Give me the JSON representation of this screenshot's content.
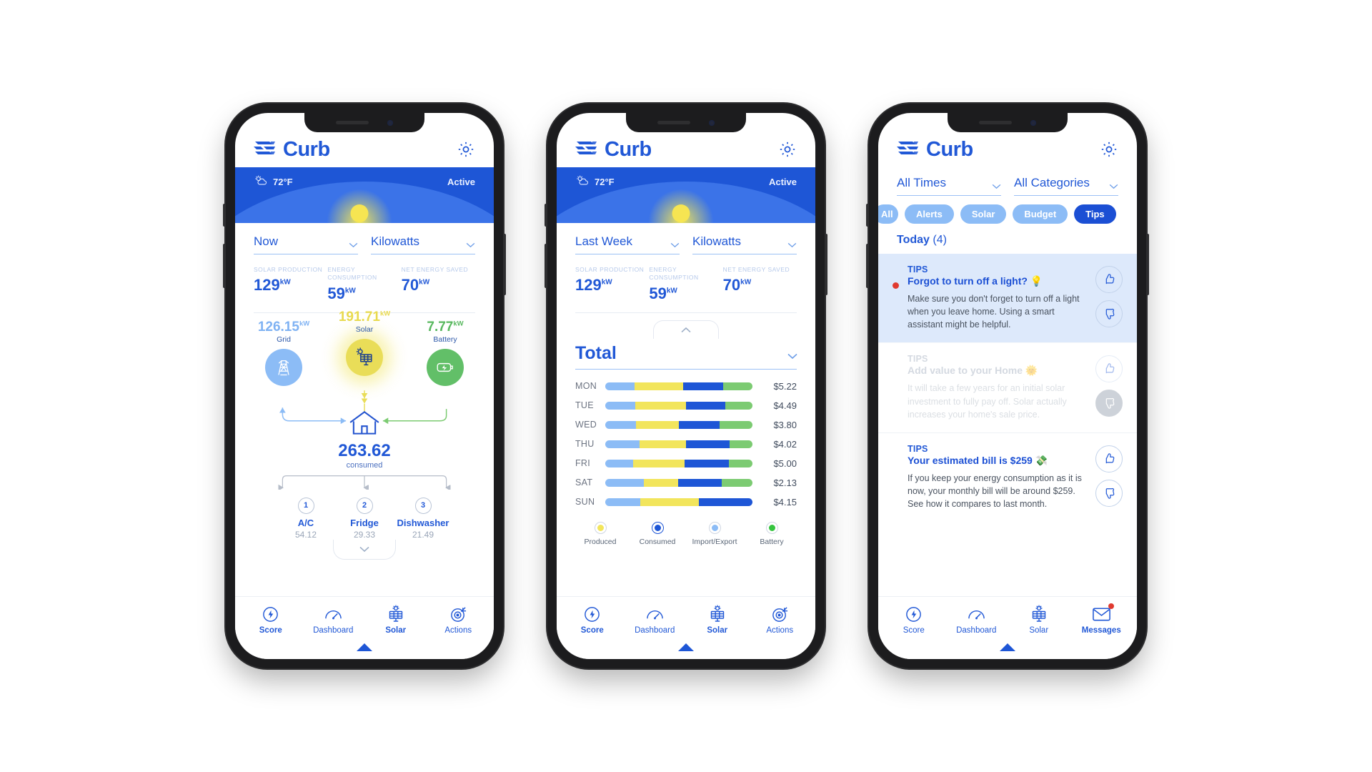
{
  "brand": {
    "name": "Curb",
    "logo_icon": "curb-logo-icon",
    "settings_icon": "gear-icon"
  },
  "phone1": {
    "weather": {
      "temperature": "72°F",
      "status": "Active",
      "icon": "partly-cloudy-icon"
    },
    "selectors": [
      {
        "name": "time-range",
        "value": "Now"
      },
      {
        "name": "units",
        "value": "Kilowatts"
      }
    ],
    "stats": [
      {
        "title": "SOLAR PRODUCTION",
        "value": "129",
        "unit": "kW"
      },
      {
        "title": "ENERGY CONSUMPTION",
        "value": "59",
        "unit": "kW"
      },
      {
        "title": "NET ENERGY SAVED",
        "value": "70",
        "unit": "kW"
      }
    ],
    "flow": {
      "grid": {
        "value": "126.15",
        "unit": "kW",
        "label": "Grid",
        "icon": "power-tower-icon"
      },
      "solar": {
        "value": "191.71",
        "unit": "kW",
        "label": "Solar",
        "icon": "solar-panel-icon"
      },
      "battery": {
        "value": "7.77",
        "unit": "kW",
        "label": "Battery",
        "icon": "battery-icon"
      },
      "house": {
        "value": "263.62",
        "label": "consumed",
        "icon": "house-icon"
      }
    },
    "appliances": [
      {
        "rank": "1",
        "name": "A/C",
        "value": "54.12"
      },
      {
        "rank": "2",
        "name": "Fridge",
        "value": "29.33"
      },
      {
        "rank": "3",
        "name": "Dishwasher",
        "value": "21.49"
      }
    ],
    "tabs": [
      {
        "label": "Score",
        "icon": "bolt-gauge-icon",
        "selected": false
      },
      {
        "label": "Dashboard",
        "icon": "gauge-icon",
        "selected": false
      },
      {
        "label": "Solar",
        "icon": "solar-panel-icon",
        "selected": true
      },
      {
        "label": "Actions",
        "icon": "target-icon",
        "selected": false
      }
    ]
  },
  "phone2": {
    "weather": {
      "temperature": "72°F",
      "status": "Active",
      "icon": "partly-cloudy-icon"
    },
    "selectors": [
      {
        "name": "time-range",
        "value": "Last Week"
      },
      {
        "name": "units",
        "value": "Kilowatts"
      }
    ],
    "stats": [
      {
        "title": "SOLAR PRODUCTION",
        "value": "129",
        "unit": "kW"
      },
      {
        "title": "ENERGY CONSUMPTION",
        "value": "59",
        "unit": "kW"
      },
      {
        "title": "NET ENERGY SAVED",
        "value": "70",
        "unit": "kW"
      }
    ],
    "section_title": "Total",
    "chart_data": {
      "type": "bar",
      "title": "Total",
      "xlabel": "",
      "ylabel": "",
      "orientation": "horizontal",
      "stacked": true,
      "categories": [
        "MON",
        "TUE",
        "WED",
        "THU",
        "FRI",
        "SAT",
        "SUN"
      ],
      "amounts": [
        "$5.22",
        "$4.49",
        "$3.80",
        "$4.02",
        "$5.00",
        "$2.13",
        "$4.15"
      ],
      "series": [
        {
          "name": "Import/Export",
          "color": "#8cbcf6",
          "values": [
            17,
            20,
            19,
            15,
            15,
            25,
            13
          ]
        },
        {
          "name": "Produced",
          "color": "#f2e55c",
          "values": [
            28,
            33,
            26,
            20,
            28,
            22,
            22
          ]
        },
        {
          "name": "Consumed",
          "color": "#1e56d6",
          "values": [
            23,
            26,
            25,
            19,
            24,
            28,
            20
          ]
        },
        {
          "name": "Battery",
          "color": "#7ccb72",
          "values": [
            17,
            18,
            20,
            10,
            13,
            20,
            0
          ]
        }
      ],
      "legend_position": "bottom",
      "grid": false
    },
    "legend": [
      {
        "label": "Produced",
        "color": "#f2e55c"
      },
      {
        "label": "Consumed",
        "color": "#1e56d6"
      },
      {
        "label": "Import/Export",
        "color": "#8cbcf6"
      },
      {
        "label": "Battery",
        "color": "#35c43f"
      }
    ],
    "tabs": [
      {
        "label": "Score",
        "icon": "bolt-gauge-icon",
        "selected": false
      },
      {
        "label": "Dashboard",
        "icon": "gauge-icon",
        "selected": false
      },
      {
        "label": "Solar",
        "icon": "solar-panel-icon",
        "selected": true
      },
      {
        "label": "Actions",
        "icon": "target-icon",
        "selected": false
      }
    ]
  },
  "phone3": {
    "filters": [
      {
        "name": "time-filter",
        "value": "All Times"
      },
      {
        "name": "category-filter",
        "value": "All Categories"
      }
    ],
    "chips": [
      {
        "label": "All",
        "active": false,
        "partial": true
      },
      {
        "label": "Alerts",
        "active": false,
        "partial": false
      },
      {
        "label": "Solar",
        "active": false,
        "partial": false
      },
      {
        "label": "Budget",
        "active": false,
        "partial": false
      },
      {
        "label": "Tips",
        "active": true,
        "partial": false
      }
    ],
    "section": {
      "label": "Today",
      "count": "(4)"
    },
    "messages": [
      {
        "kind": "TIPS",
        "title": "Forgot to turn off a light? 💡",
        "text": "Make sure you don't forget to turn off a light when you leave home. Using a smart assistant might be helpful.",
        "unread": true,
        "faded": false,
        "thumb_up_active": false,
        "thumb_down_active": false
      },
      {
        "kind": "TIPS",
        "title": "Add value to your Home 🌞",
        "text": "It will take a few years for an initial solar investment to fully pay off. Solar actually increases your home's sale price.",
        "unread": false,
        "faded": true,
        "thumb_up_active": false,
        "thumb_down_active": true
      },
      {
        "kind": "TIPS",
        "title": "Your estimated bill is $259 💸",
        "text": "If you keep your energy consumption as it is now, your monthly bill will be around $259. See how it compares to last month.",
        "unread": false,
        "faded": false,
        "thumb_up_active": false,
        "thumb_down_active": false
      }
    ],
    "tabs": [
      {
        "label": "Score",
        "icon": "bolt-gauge-icon",
        "selected": false
      },
      {
        "label": "Dashboard",
        "icon": "gauge-icon",
        "selected": false
      },
      {
        "label": "Solar",
        "icon": "solar-panel-icon",
        "selected": false
      },
      {
        "label": "Messages",
        "icon": "envelope-icon",
        "selected": true,
        "has_notification": true
      }
    ]
  },
  "colors": {
    "brand_blue": "#2158d6",
    "deep_blue": "#1e56d6",
    "solar_yellow": "#e9dd58",
    "grid_blue": "#8cbcf6",
    "battery_green": "#62bf68",
    "alert_red": "#e03a2f"
  }
}
